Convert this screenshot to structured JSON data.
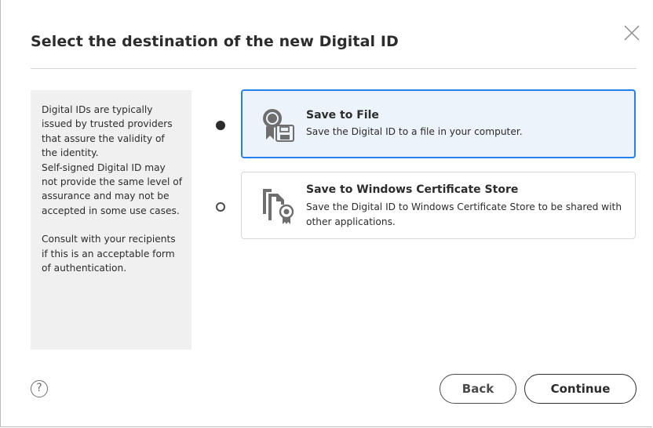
{
  "dialog": {
    "title": "Select the destination of the new Digital ID"
  },
  "info_panel": {
    "paragraph1": "Digital IDs are typically issued by trusted providers that assure the validity of the identity.",
    "paragraph2": "Self-signed Digital ID may not provide the same level of assurance and may not be accepted in some use cases.",
    "paragraph3": "Consult with your recipients if this is an acceptable form of authentication."
  },
  "options": [
    {
      "title": "Save to File",
      "description": "Save the Digital ID to a file in your computer.",
      "selected": true,
      "icon": "certificate-file-icon"
    },
    {
      "title": "Save to Windows Certificate Store",
      "description": "Save the Digital ID to Windows Certificate Store to be shared with other applications.",
      "selected": false,
      "icon": "certificate-store-icon"
    }
  ],
  "footer": {
    "help_label": "?",
    "back_label": "Back",
    "continue_label": "Continue"
  },
  "colors": {
    "accent": "#2680eb",
    "selected_bg": "#edf3fa",
    "panel_bg": "#f0f0f0"
  }
}
